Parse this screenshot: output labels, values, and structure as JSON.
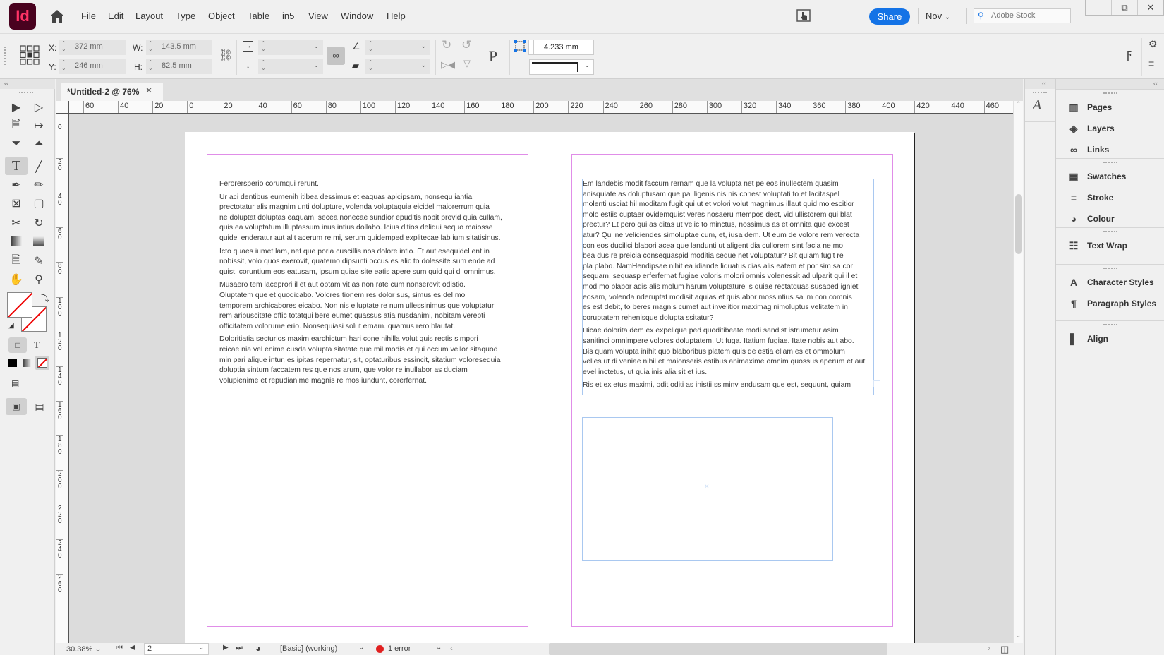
{
  "app": {
    "name": "Id",
    "brand_bg": "#49021f",
    "brand_fg": "#ff3366"
  },
  "menu": [
    "File",
    "Edit",
    "Layout",
    "Type",
    "Object",
    "Table",
    "in5",
    "View",
    "Window",
    "Help"
  ],
  "topbar": {
    "share_label": "Share",
    "share_color": "#1473e6",
    "workspace": "Nov",
    "stock_placeholder": "Adobe Stock",
    "window_controls": [
      "minimize",
      "restore",
      "close"
    ]
  },
  "control": {
    "x_label": "X:",
    "x_value": "372 mm",
    "y_label": "Y:",
    "y_value": "246 mm",
    "w_label": "W:",
    "w_value": "143.5 mm",
    "h_label": "H:",
    "h_value": "82.5 mm",
    "stroke_weight": "4.233 mm"
  },
  "document": {
    "tab_title": "*Untitled-2 @ 76%",
    "h_ruler": [
      "60",
      "40",
      "20",
      "0",
      "20",
      "40",
      "60",
      "80",
      "100",
      "120",
      "140",
      "160",
      "180",
      "200",
      "220",
      "240",
      "260",
      "280",
      "300",
      "320",
      "340",
      "360",
      "380",
      "400",
      "420",
      "440",
      "460"
    ],
    "v_ruler": [
      "0",
      "20",
      "40",
      "60",
      "80",
      "100",
      "120",
      "140",
      "160",
      "180",
      "200",
      "220",
      "240",
      "260"
    ],
    "left_frame": [
      [
        "Ferorersperio corumqui rerunt."
      ],
      [
        "Ur aci dentibus eumenih itibea dessimus et eaquas apicipsam, nonsequ iantia",
        "prectotatur alis magnim unti dolupture, volenda voluptaquia eicidel maiorerrum quia",
        "ne doluptat doluptas eaquam, secea nonecae sundior epuditis nobit provid quia cullam,",
        "quis ea voluptatum illuptassum inus intius dollabo. Icius ditios deliqui sequo maiosse",
        "quidel enderatur aut alit acerum re mi, serum quidemped explitecae lab ium sitatisinus."
      ],
      [
        "Icto quaes iumet lam, net que poria cuscillis nos dolore intio. Et aut esequidel ent in",
        "nobissit, volo quos exerovit, quatemo dipsunti occus es alic to dolessite sum ende ad",
        "quist, coruntium eos eatusam, ipsum quiae site eatis apere sum quid qui di omnimus."
      ],
      [
        "Musaero tem laceprori il et aut optam vit as non rate cum nonserovit odistio.",
        "Oluptatem que et quodicabo. Volores tionem res dolor sus, simus es del mo",
        "temporem archicabores eicabo. Non nis elluptate re num ullessinimus que voluptatur",
        "rem aribuscitate offic totatqui bere eumet quassus atia nusdanimi, nobitam verepti",
        "officitatem volorume erio. Nonsequiasi solut ernam. quamus rero blautat."
      ],
      [
        "Doloritiatia secturios maxim earchictum hari cone nihilla volut quis rectis simpori",
        "reicae nia vel enime cusda volupta sitatate que mil modis et qui occum vellor sitaquod",
        "min pari alique intur, es ipitas repernatur, sit, optaturibus essincit, sitatium voloresequia",
        "doluptia sintum faccatem res que nos arum, que volor re inullabor as duciam",
        "volupienime et repudianime magnis re mos iundunt, corerfernat."
      ]
    ],
    "right_frame": [
      [
        "Em landebis modit faccum rernam que la volupta net pe eos inullectem quasim",
        "anisquiate as doluptusam que pa iligenis nis nis conest voluptati to et lacitaspel",
        "molenti usciat hil moditam fugit qui ut et volori volut magnimus illaut quid molescitior",
        "molo estiis cuptaer ovidemquist veres nosaeru ntempos dest, vid ullistorem qui blat",
        "prectur? Et pero qui as ditas ut velic to minctus, nossimus as et omnita que excest",
        "atur? Qui ne veliciendes simoluptae cum, et, iusa dem. Ut eum de volore rem verecta",
        "con eos ducilici blabori acea que landunti ut aligent dia cullorem sint facia ne mo",
        "bea dus re preicia consequaspid moditia seque net voluptatur? Bit quiam fugit re",
        "pla plabo. NamHendipsae nihit ea idiande liquatus dias alis eatem et por sim sa cor",
        "sequam, sequasp erferfernat fugiae voloris molori omnis volenessit ad ulparit qui il et",
        "mod mo blabor adis alis molum harum voluptature is quiae rectatquas susaped igniet",
        "eosam, volenda nderuptat modisit aquias et quis abor mossintius sa im con comnis",
        "es est debit, to beres magnis cumet aut invelitior maximag nimoluptus velitatem in",
        "coruptatem rehenisque dolupta ssitatur?"
      ],
      [
        "Hicae dolorita dem ex expelique ped quoditibeate modi sandist istrumetur asim",
        "sanitinci omnimpere volores doluptatem. Ut fuga. Itatium fugiae. Itate nobis aut abo.",
        "Bis quam volupta inihit quo blaboribus platem quis de estia ellam es et ommolum",
        "velles ut di veniae nihil et maionseris estibus animaxime omnim quossus aperum et aut",
        "evel inctetus, ut quia inis alia sit et ius."
      ],
      [
        "Ris et ex etus maximi, odit oditi as inistii ssiminv endusam que est, sequunt, quiam"
      ]
    ]
  },
  "status": {
    "zoom": "30.38%",
    "page": "2",
    "profile": "[Basic] (working)",
    "errors": "1 error",
    "error_color": "#e02020"
  },
  "panels": {
    "groups": [
      [
        {
          "label": "Pages",
          "icon": "pages-icon"
        },
        {
          "label": "Layers",
          "icon": "layers-icon"
        },
        {
          "label": "Links",
          "icon": "links-icon"
        }
      ],
      [
        {
          "label": "Swatches",
          "icon": "swatches-icon"
        },
        {
          "label": "Stroke",
          "icon": "stroke-icon"
        },
        {
          "label": "Colour",
          "icon": "colour-icon"
        }
      ],
      [
        {
          "label": "Text Wrap",
          "icon": "text-wrap-icon"
        }
      ],
      [
        {
          "label": "Character Styles",
          "icon": "character-styles-icon"
        },
        {
          "label": "Paragraph Styles",
          "icon": "paragraph-styles-icon"
        }
      ],
      [
        {
          "label": "Align",
          "icon": "align-icon"
        }
      ]
    ]
  }
}
